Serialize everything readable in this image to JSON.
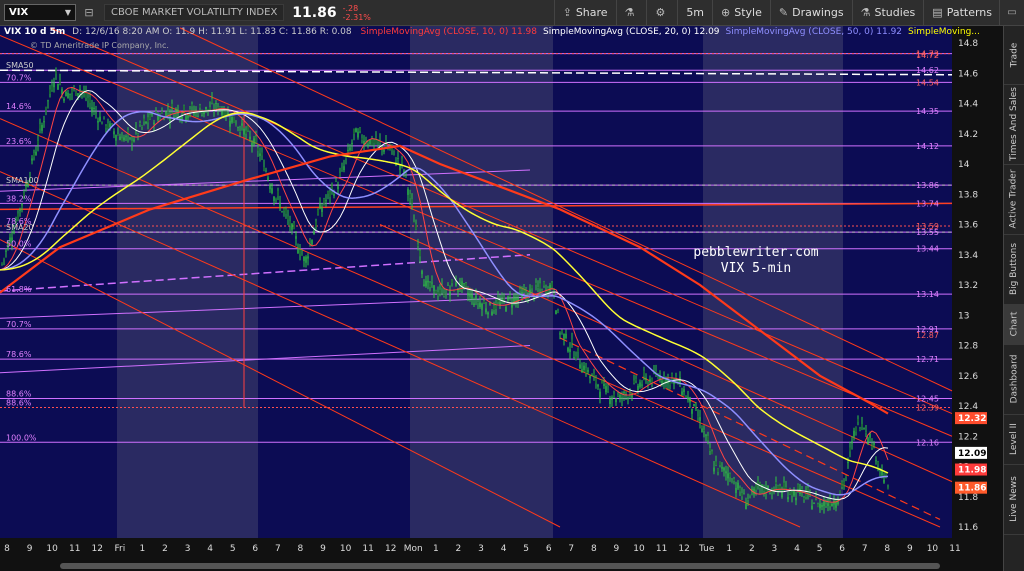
{
  "toolbar": {
    "symbol": "VIX",
    "description": "CBOE MARKET VOLATILITY INDEX",
    "last_price": "11.86",
    "change": "-.28",
    "change_pct": "-2.31%",
    "share_label": "Share",
    "interval_label": "5m",
    "style_label": "Style",
    "drawings_label": "Drawings",
    "studies_label": "Studies",
    "patterns_label": "Patterns"
  },
  "header": {
    "title": "VIX 10 d 5m",
    "ohlc_line": "D: 12/6/16 8:20 AM  O: 11.9  H: 11.91  L: 11.83  C: 11.86  R: 0.08",
    "copyright": "© TD Ameritrade IP Company, Inc.",
    "studies": [
      {
        "label": "SimpleMovingAvg (CLOSE, 10, 0)",
        "value": "11.98",
        "color": "#ff3b3b"
      },
      {
        "label": "SimpleMovingAvg (CLOSE, 20, 0)",
        "value": "12.09",
        "color": "#ffffff"
      },
      {
        "label": "SimpleMovingAvg (CLOSE, 50, 0)",
        "value": "11.92",
        "color": "#8f8fff"
      },
      {
        "label": "SimpleMoving...",
        "value": "",
        "color": "#ffff00"
      }
    ]
  },
  "price_axis": {
    "ticks": [
      "14.8",
      "14.6",
      "14.4",
      "14.2",
      "14",
      "13.8",
      "13.6",
      "13.4",
      "13.2",
      "13",
      "12.8",
      "12.6",
      "12.4",
      "12.2",
      "12",
      "11.8",
      "11.6"
    ],
    "level_labels": [
      "14.73",
      "14.72",
      "14.62",
      "14.54",
      "14.35",
      "14.12",
      "13.86",
      "13.74",
      "13.59",
      "13.55",
      "13.44",
      "13.14",
      "12.91",
      "12.87",
      "12.71",
      "12.45",
      "12.39",
      "12.16"
    ],
    "badges": [
      {
        "value": "12.32",
        "color": "#ff4d2e"
      },
      {
        "value": "12.09",
        "color": "#ffffff"
      },
      {
        "value": "11.98",
        "color": "#ff3b3b"
      },
      {
        "value": "11.86",
        "color": "#ff5a2a"
      }
    ]
  },
  "fib_labels": [
    "100.0%",
    "88.6%",
    "88.6%",
    "78.6%",
    "70.7%",
    "61.8%",
    "50.0%",
    "38.2%",
    "23.6%",
    "14.6%",
    "70.7%",
    "78.6%",
    "SMA50",
    "SMA100",
    "SMA20"
  ],
  "time_axis": [
    "8",
    "9",
    "10",
    "11",
    "12",
    "Fri",
    "1",
    "2",
    "3",
    "4",
    "5",
    "6",
    "7",
    "8",
    "9",
    "10",
    "11",
    "12",
    "Mon",
    "1",
    "2",
    "3",
    "4",
    "5",
    "6",
    "7",
    "8",
    "9",
    "10",
    "11",
    "12",
    "Tue",
    "1",
    "2",
    "3",
    "4",
    "5",
    "6",
    "7",
    "8",
    "9",
    "10",
    "11"
  ],
  "watermark": {
    "line1": "pebblewriter.com",
    "line2": "VIX 5-min"
  },
  "side_tabs": [
    "Trade",
    "Times And Sales",
    "Active Trader",
    "Big Buttons",
    "Chart",
    "Dashboard",
    "Level II",
    "Live News"
  ],
  "colors": {
    "chart_bg": "#0c0c54",
    "session_shade": "#2a2a62",
    "candle": "#2ecc40",
    "fib_line": "#d070ff",
    "channel": "#ff3a1a"
  }
}
